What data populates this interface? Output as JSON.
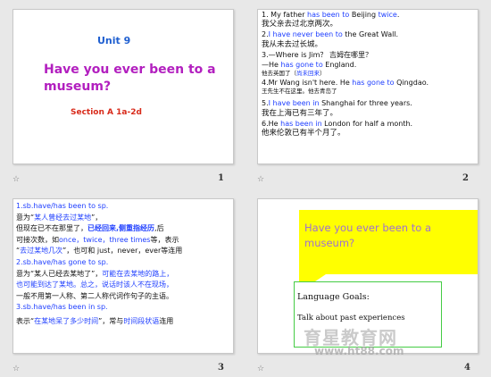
{
  "slide1": {
    "number": "1",
    "unit": "Unit 9",
    "title_line1": "Have you ever been to a",
    "title_line2": "museum?",
    "section": "Section A   1a-2d"
  },
  "slide2": {
    "number": "2",
    "lines": [
      {
        "a": "1.  My father ",
        "b": "has been to",
        "c": " Beijing ",
        "d": "twice",
        "e": "."
      },
      {
        "cn": "我父亲去过北京两次。"
      },
      {
        "a": "2.",
        "b": "I have never been to",
        "c": " the Great Wall."
      },
      {
        "cn": "我从未去过长城。"
      },
      {
        "a": "3.—Where is Jim？ 吉姆在哪里？"
      },
      {
        "a": "—He ",
        "b": "has gone to",
        "c": " England."
      },
      {
        "small": "他去英国了（",
        "small_b": "尚未回来",
        "small_c": "）"
      },
      {
        "a": "4.Mr Wang isn't here.  He ",
        "b": "has gone to",
        "c": " Qingdao."
      },
      {
        "small": "王先生不在这里。他去青岛了"
      },
      {
        "a": "5.",
        "b": "I have been in",
        "c": " Shanghai for three years."
      },
      {
        "cn": "我在上海已有三年了。"
      },
      {
        "a": "6.He ",
        "b": "has been in",
        "c": " London for half a month."
      },
      {
        "cn": "他来伦敦已有半个月了。"
      }
    ]
  },
  "slide3": {
    "number": "3",
    "h1": "1.sb.have/has been to sp.",
    "p1a": "      意为“",
    "p1b": "某人曾经去过某地",
    "p1c": "”，",
    "p2a": "但现在已不在那里了，",
    "p2b": "已经回来,侧重指经历",
    "p2c": ",后",
    "p3a": "可接次数，如",
    "p3b": "once，twice，three times",
    "p3c": "等，表示",
    "p4a": "“",
    "p4b": "去过某地几次",
    "p4c": "”，也可和 just，never，ever等连用",
    "h2": "2.sb.have/has gone to sp.",
    "p5a": "意为“某人已经去某地了”，",
    "p5b": "可能在去某地的路上，",
    "p6": "也可能到达了某地。总之，说话时该人不在现场，",
    "p7": "一般不用第一人称、第二人称代词作句子的主语。",
    "h3": "3.sb.have/has been in sp.",
    "p8a": "表示“",
    "p8b": "在某地呆了多少时间",
    "p8c": "”，常与",
    "p8d": "时间段状语",
    "p8e": "连用"
  },
  "slide4": {
    "number": "4",
    "title_line1": "Have you ever been to a",
    "title_line2": "museum?",
    "goals": "Language Goals:",
    "talk": "Talk about past experiences"
  },
  "watermark": {
    "text": "育星教育网",
    "url": "www.ht88.com"
  },
  "star": "☆"
}
